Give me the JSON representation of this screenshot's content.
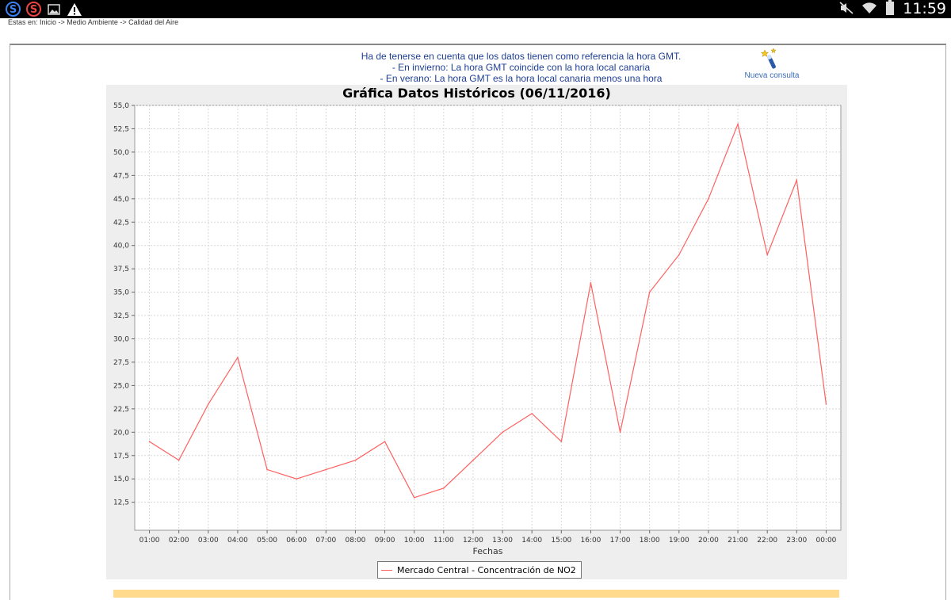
{
  "statusbar": {
    "time": "11:59",
    "left_icons": [
      "s-blue-icon",
      "s-red-icon",
      "image-icon",
      "warning-icon"
    ],
    "right_icons": [
      "mute-icon",
      "wifi-icon",
      "battery-icon"
    ]
  },
  "breadcrumb": "Estas en: Inicio -> Medio Ambiente -> Calidad del Aire",
  "notice": {
    "line1": "Ha de tenerse en cuenta que los datos tienen como referencia la hora GMT.",
    "line2": "- En invierno: La hora GMT coincide con la hora local canaria",
    "line3": "- En verano: La hora GMT es la hora local canaria menos una hora"
  },
  "nueva_consulta": {
    "label": "Nueva consulta",
    "icon": "magic-wand-icon"
  },
  "chart_data": {
    "type": "line",
    "title": "Gráfica Datos Históricos (06/11/2016)",
    "xlabel": "Fechas",
    "ylabel": "",
    "categories": [
      "01:00",
      "02:00",
      "03:00",
      "04:00",
      "05:00",
      "06:00",
      "07:00",
      "08:00",
      "09:00",
      "10:00",
      "11:00",
      "12:00",
      "13:00",
      "14:00",
      "15:00",
      "16:00",
      "17:00",
      "18:00",
      "19:00",
      "20:00",
      "21:00",
      "22:00",
      "23:00",
      "00:00"
    ],
    "y_ticks": [
      "12,5",
      "15,0",
      "17,5",
      "20,0",
      "22,5",
      "25,0",
      "27,5",
      "30,0",
      "32,5",
      "35,0",
      "37,5",
      "40,0",
      "42,5",
      "45,0",
      "47,5",
      "50,0",
      "52,5",
      "55,0"
    ],
    "ylim": [
      9.5,
      55
    ],
    "grid": true,
    "legend_position": "bottom",
    "series": [
      {
        "name": "Mercado Central - Concentración de NO2",
        "color": "#ff6060",
        "values": [
          19,
          17,
          23,
          28,
          16,
          15,
          16,
          17,
          19,
          13,
          14,
          17,
          20,
          22,
          19,
          36,
          20,
          35,
          39,
          45,
          53,
          39,
          47,
          23
        ]
      }
    ]
  },
  "colors": {
    "panel_bg": "#eeeeee",
    "series_line": "#ff6060",
    "notice_text": "#1f3f95",
    "link_text": "#3b6cb4"
  }
}
